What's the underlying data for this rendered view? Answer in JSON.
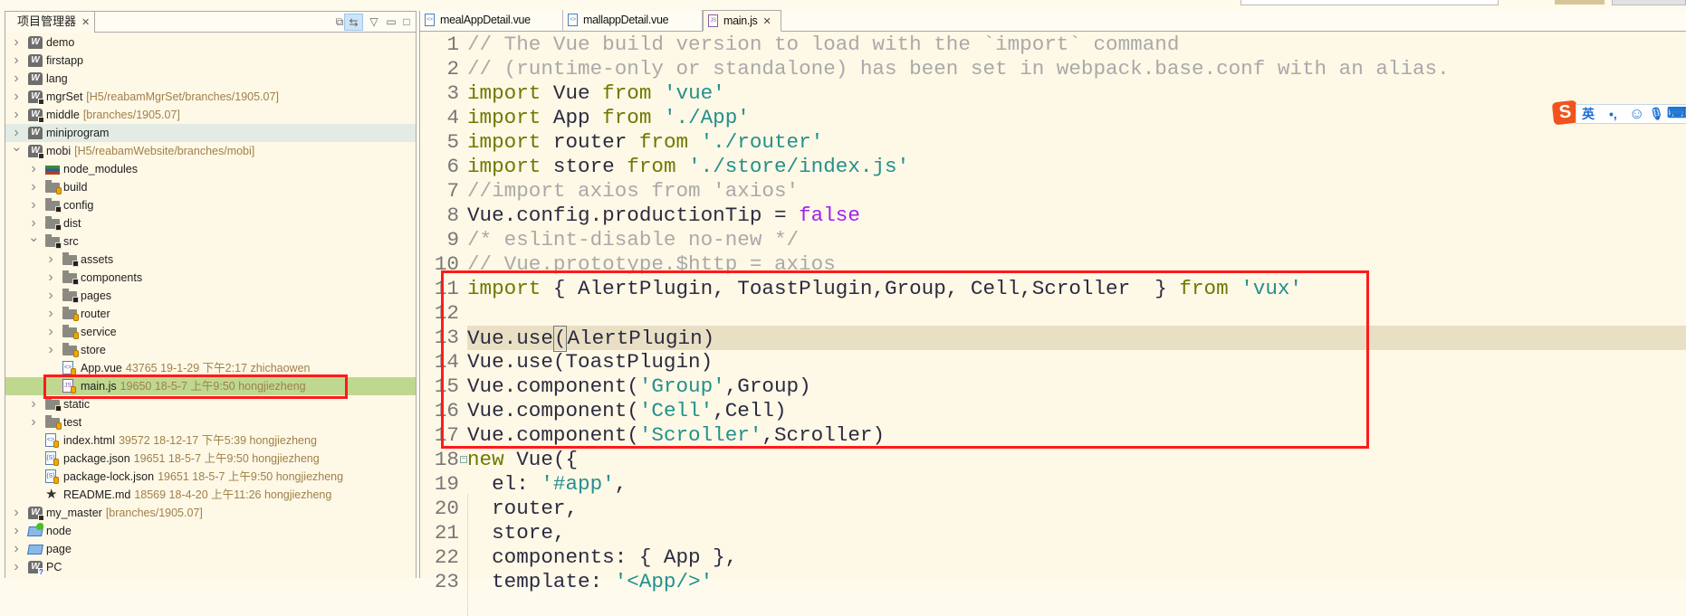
{
  "project_explorer": {
    "title": "项目管理器",
    "close_glyph": "✕",
    "toolbar": [
      "collapse-all-icon",
      "link-with-editor-icon",
      "view-menu-icon",
      "minimize-icon",
      "maximize-icon"
    ],
    "rows": [
      {
        "level": 0,
        "arrow": "right",
        "icon": "project",
        "name": "demo",
        "deco": ""
      },
      {
        "level": 0,
        "arrow": "right",
        "icon": "project",
        "name": "firstapp",
        "deco": ""
      },
      {
        "level": 0,
        "arrow": "right",
        "icon": "project",
        "name": "lang",
        "deco": ""
      },
      {
        "level": 0,
        "arrow": "right",
        "icon": "project-svn",
        "name": "mgrSet",
        "deco": "[H5/reabamMgrSet/branches/1905.07]"
      },
      {
        "level": 0,
        "arrow": "right",
        "icon": "project-svn",
        "name": "middle",
        "deco": "[branches/1905.07]"
      },
      {
        "level": 0,
        "arrow": "right",
        "icon": "project",
        "name": "miniprogram",
        "deco": "",
        "state": "hover"
      },
      {
        "level": 0,
        "arrow": "down",
        "icon": "project-svn",
        "name": "mobi",
        "deco": "[H5/reabamWebsite/branches/mobi]"
      },
      {
        "level": 1,
        "arrow": "right",
        "icon": "library",
        "name": "node_modules",
        "deco": ""
      },
      {
        "level": 1,
        "arrow": "right",
        "icon": "folder-versioned",
        "name": "build",
        "deco": ""
      },
      {
        "level": 1,
        "arrow": "right",
        "icon": "folder-modified",
        "name": "config",
        "deco": ""
      },
      {
        "level": 1,
        "arrow": "right",
        "icon": "folder-modified",
        "name": "dist",
        "deco": ""
      },
      {
        "level": 1,
        "arrow": "down",
        "icon": "folder-modified",
        "name": "src",
        "deco": ""
      },
      {
        "level": 2,
        "arrow": "right",
        "icon": "folder-modified",
        "name": "assets",
        "deco": ""
      },
      {
        "level": 2,
        "arrow": "right",
        "icon": "folder-modified",
        "name": "components",
        "deco": ""
      },
      {
        "level": 2,
        "arrow": "right",
        "icon": "folder-modified",
        "name": "pages",
        "deco": ""
      },
      {
        "level": 2,
        "arrow": "right",
        "icon": "folder-versioned",
        "name": "router",
        "deco": ""
      },
      {
        "level": 2,
        "arrow": "right",
        "icon": "folder-versioned",
        "name": "service",
        "deco": ""
      },
      {
        "level": 2,
        "arrow": "right",
        "icon": "folder-versioned",
        "name": "store",
        "deco": ""
      },
      {
        "level": 2,
        "arrow": "none",
        "icon": "file-vue",
        "name": "App.vue",
        "deco": "43765  19-1-29 下午2:17  zhichaowen"
      },
      {
        "level": 2,
        "arrow": "none",
        "icon": "file-js",
        "name": "main.js",
        "deco": "19650  18-5-7 上午9:50  hongjiezheng",
        "state": "selected"
      },
      {
        "level": 1,
        "arrow": "right",
        "icon": "folder-modified",
        "name": "static",
        "deco": ""
      },
      {
        "level": 1,
        "arrow": "right",
        "icon": "folder-versioned",
        "name": "test",
        "deco": ""
      },
      {
        "level": 1,
        "arrow": "none",
        "icon": "file-html",
        "name": "index.html",
        "deco": "39572  18-12-17 下午5:39  hongjiezheng"
      },
      {
        "level": 1,
        "arrow": "none",
        "icon": "file-json",
        "name": "package.json",
        "deco": "19651  18-5-7 上午9:50  hongjiezheng"
      },
      {
        "level": 1,
        "arrow": "none",
        "icon": "file-json",
        "name": "package-lock.json",
        "deco": "19651  18-5-7 上午9:50  hongjiezheng"
      },
      {
        "level": 1,
        "arrow": "none",
        "icon": "file-md",
        "name": "README.md",
        "deco": "18569  18-4-20 上午11:26  hongjiezheng"
      },
      {
        "level": 0,
        "arrow": "right",
        "icon": "project-svn",
        "name": "my_master",
        "deco": "[branches/1905.07]"
      },
      {
        "level": 0,
        "arrow": "right",
        "icon": "folder-open-green",
        "name": "node",
        "deco": ""
      },
      {
        "level": 0,
        "arrow": "right",
        "icon": "folder-open",
        "name": "page",
        "deco": ""
      },
      {
        "level": 0,
        "arrow": "right",
        "icon": "project-unknown",
        "name": "PC",
        "deco": ""
      }
    ]
  },
  "editor": {
    "tabs": [
      {
        "label": "mealAppDetail.vue",
        "type": "vue",
        "active": false
      },
      {
        "label": "mallappDetail.vue",
        "type": "vue",
        "active": false
      },
      {
        "label": "main.js",
        "type": "js",
        "active": true,
        "close": "✕"
      }
    ],
    "current_line": 13,
    "lines": [
      [
        [
          "c",
          "// The Vue build version to load with the `import` command"
        ]
      ],
      [
        [
          "c",
          "// (runtime-only or standalone) has been set in webpack.base.conf with an alias."
        ]
      ],
      [
        [
          "k",
          "import"
        ],
        [
          "n",
          " Vue "
        ],
        [
          "k",
          "from"
        ],
        [
          "n",
          " "
        ],
        [
          "s",
          "'vue'"
        ]
      ],
      [
        [
          "k",
          "import"
        ],
        [
          "n",
          " App "
        ],
        [
          "k",
          "from"
        ],
        [
          "n",
          " "
        ],
        [
          "s",
          "'./App'"
        ]
      ],
      [
        [
          "k",
          "import"
        ],
        [
          "n",
          " router "
        ],
        [
          "k",
          "from"
        ],
        [
          "n",
          " "
        ],
        [
          "s",
          "'./router'"
        ]
      ],
      [
        [
          "k",
          "import"
        ],
        [
          "n",
          " store "
        ],
        [
          "k",
          "from"
        ],
        [
          "n",
          " "
        ],
        [
          "s",
          "'./store/index.js'"
        ]
      ],
      [
        [
          "c",
          "//import axios from 'axios'"
        ]
      ],
      [
        [
          "n",
          "Vue.config.productionTip = "
        ],
        [
          "b",
          "false"
        ]
      ],
      [
        [
          "c",
          "/* eslint-disable no-new */"
        ]
      ],
      [
        [
          "c",
          "// Vue.prototype.$http = axios"
        ]
      ],
      [
        [
          "k",
          "import"
        ],
        [
          "n",
          " { AlertPlugin, ToastPlugin,Group, Cell,Scroller  } "
        ],
        [
          "k",
          "from"
        ],
        [
          "n",
          " "
        ],
        [
          "s",
          "'vux'"
        ]
      ],
      [],
      [
        [
          "n",
          "Vue.use"
        ],
        [
          "caret",
          "("
        ],
        [
          "n",
          "AlertPlugin)"
        ]
      ],
      [
        [
          "n",
          "Vue.use(ToastPlugin)"
        ]
      ],
      [
        [
          "n",
          "Vue.component("
        ],
        [
          "s",
          "'Group'"
        ],
        [
          "n",
          ",Group)"
        ]
      ],
      [
        [
          "n",
          "Vue.component("
        ],
        [
          "s",
          "'Cell'"
        ],
        [
          "n",
          ",Cell)"
        ]
      ],
      [
        [
          "n",
          "Vue.component("
        ],
        [
          "s",
          "'Scroller'"
        ],
        [
          "n",
          ",Scroller)"
        ]
      ],
      [
        [
          "k",
          "new"
        ],
        [
          "n",
          " Vue({"
        ]
      ],
      [
        [
          "n",
          "  el: "
        ],
        [
          "s",
          "'#app'"
        ],
        [
          "n",
          ","
        ]
      ],
      [
        [
          "n",
          "  router,"
        ]
      ],
      [
        [
          "n",
          "  store,"
        ]
      ],
      [
        [
          "n",
          "  components: { App },"
        ]
      ],
      [
        [
          "n",
          "  template: "
        ],
        [
          "s",
          "'<App/>'"
        ]
      ]
    ]
  },
  "ime": {
    "logo": "S",
    "lang": "英",
    "punct": "•,",
    "emoji": "☺",
    "mic": "🎙",
    "keyboard": "⌨"
  },
  "colors": {
    "highlight_box": "#ff1a1a",
    "selected_row": "#bfd890",
    "current_line": "#e9dfc4",
    "keyword": "#6b7a00",
    "string": "#23908c",
    "comment": "#a9a9a9",
    "boolean": "#a020f0"
  }
}
